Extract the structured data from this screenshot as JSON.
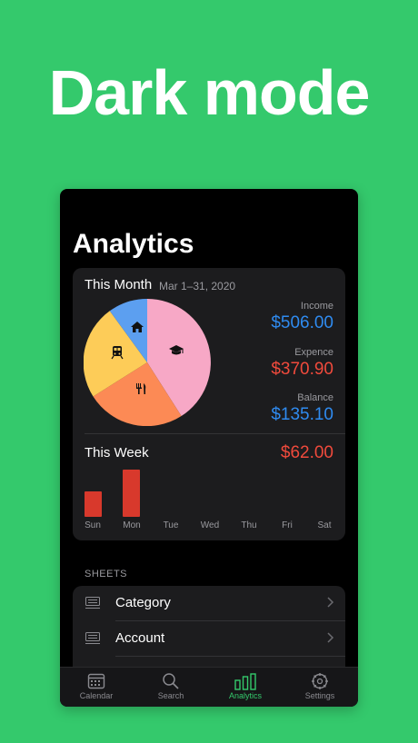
{
  "headline": "Dark mode",
  "page_title": "Analytics",
  "month": {
    "title": "This Month",
    "range": "Mar 1–31, 2020",
    "income_label": "Income",
    "income_value": "$506.00",
    "expense_label": "Expence",
    "expense_value": "$370.90",
    "balance_label": "Balance",
    "balance_value": "$135.10",
    "pie_categories": [
      {
        "icon": "graduation-cap-icon",
        "color": "#f7a8c6"
      },
      {
        "icon": "fork-knife-icon",
        "color": "#fc8a55"
      },
      {
        "icon": "train-icon",
        "color": "#fdcc58"
      },
      {
        "icon": "house-icon",
        "color": "#5c9ff0"
      }
    ]
  },
  "week": {
    "title": "This Week",
    "total": "$62.00",
    "days": [
      "Sun",
      "Mon",
      "Tue",
      "Wed",
      "Thu",
      "Fri",
      "Sat"
    ]
  },
  "sheets": {
    "section_label": "SHEETS",
    "items": [
      {
        "label": "Category"
      },
      {
        "label": "Account"
      }
    ]
  },
  "tabbar": {
    "tabs": [
      {
        "label": "Calendar",
        "icon": "calendar-icon"
      },
      {
        "label": "Search",
        "icon": "search-icon"
      },
      {
        "label": "Analytics",
        "icon": "bar-chart-icon",
        "active": true
      },
      {
        "label": "Settings",
        "icon": "gear-icon"
      }
    ]
  },
  "colors": {
    "background": "#34c96c",
    "accent": "#34c96c",
    "income": "#2f8bf0",
    "expense": "#f04a3c",
    "bars": "#d8392c"
  }
}
